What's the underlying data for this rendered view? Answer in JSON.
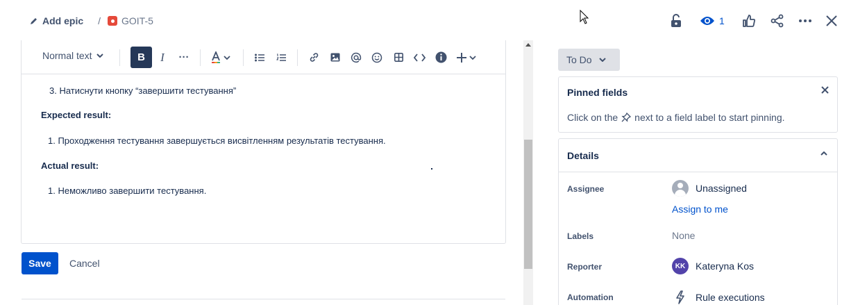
{
  "breadcrumb": {
    "add_epic": "Add epic",
    "separator": "/",
    "issue_key": "GOIT-5"
  },
  "header_actions": {
    "watch_count": "1"
  },
  "toolbar": {
    "text_style": "Normal text",
    "bold": "B",
    "italic": "I",
    "more": "···"
  },
  "editor": {
    "step3": "3. Натиснути кнопку “завершити тестування”",
    "expected_heading": "Expected result:",
    "expected_item": "1. Проходження тестування завершується висвітленням результатів тестування.",
    "actual_heading": "Actual result:",
    "actual_item": "1. Неможливо завершити тестування."
  },
  "buttons": {
    "save": "Save",
    "cancel": "Cancel"
  },
  "status": {
    "label": "To Do"
  },
  "pinned": {
    "title": "Pinned fields",
    "hint_before": "Click on the",
    "hint_after": "next to a field label to start pinning."
  },
  "details": {
    "title": "Details",
    "assignee_label": "Assignee",
    "assignee_value": "Unassigned",
    "assign_to_me": "Assign to me",
    "labels_label": "Labels",
    "labels_value": "None",
    "reporter_label": "Reporter",
    "reporter_initials": "KK",
    "reporter_value": "Kateryna Kos",
    "automation_label": "Automation",
    "automation_value": "Rule executions"
  },
  "colors": {
    "primary": "#0052cc",
    "text": "#172b4d",
    "muted": "#42526e",
    "border": "#dfe1e6",
    "bug": "#e5493a",
    "reporter_avatar": "#5243aa"
  }
}
